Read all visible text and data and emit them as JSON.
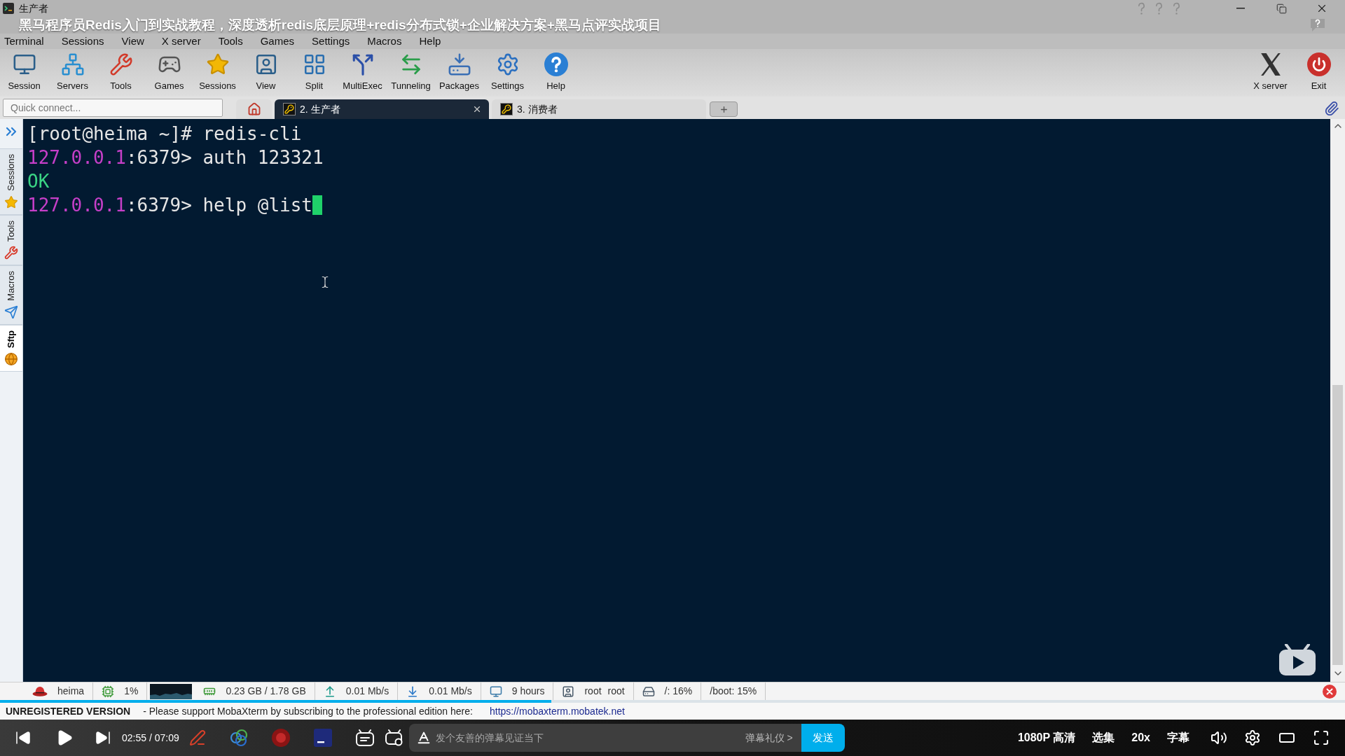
{
  "window": {
    "title": "生产者"
  },
  "video_title": "黑马程序员Redis入门到实战教程，深度透析redis底层原理+redis分布式锁+企业解决方案+黑马点评实战项目",
  "menu": [
    "Terminal",
    "Sessions",
    "View",
    "X server",
    "Tools",
    "Games",
    "Settings",
    "Macros",
    "Help"
  ],
  "toolbar": {
    "left": [
      "Session",
      "Servers",
      "Tools",
      "Games",
      "Sessions",
      "View",
      "Split",
      "MultiExec",
      "Tunneling",
      "Packages",
      "Settings",
      "Help"
    ],
    "right": [
      "X server",
      "Exit"
    ]
  },
  "quick_connect": {
    "placeholder": "Quick connect..."
  },
  "tabs": [
    {
      "kind": "home",
      "selected": false
    },
    {
      "kind": "session",
      "label": "2. 生产者",
      "selected": true
    },
    {
      "kind": "session",
      "label": "3. 消费者",
      "selected": false
    }
  ],
  "sidebar": {
    "tabs": [
      {
        "label": "Sessions",
        "selected": false
      },
      {
        "label": "Tools",
        "selected": false
      },
      {
        "label": "Macros",
        "selected": false
      },
      {
        "label": "Sftp",
        "selected": true
      }
    ]
  },
  "terminal": {
    "lines": [
      {
        "segments": [
          {
            "text": "[root@heima ~]# redis-cli",
            "color": "#e6e6e6"
          }
        ],
        "cursor": false
      },
      {
        "segments": [
          {
            "text": "127.0.0.1",
            "color": "#c63fc8"
          },
          {
            "text": ":6379> auth 123321",
            "color": "#e6e6e6"
          }
        ],
        "cursor": false
      },
      {
        "segments": [
          {
            "text": "OK",
            "color": "#3ad484"
          }
        ],
        "cursor": false
      },
      {
        "segments": [
          {
            "text": "127.0.0.1",
            "color": "#c63fc8"
          },
          {
            "text": ":6379> help @list",
            "color": "#e6e6e6"
          }
        ],
        "cursor": true
      }
    ]
  },
  "status_bar": {
    "items": [
      {
        "kind": "host",
        "text": "heima"
      },
      {
        "kind": "cpu",
        "text": "1%"
      },
      {
        "kind": "graph"
      },
      {
        "kind": "memory",
        "text": "0.23 GB / 1.78 GB"
      },
      {
        "kind": "upload",
        "text": "0.01 Mb/s"
      },
      {
        "kind": "download",
        "text": "0.01 Mb/s"
      },
      {
        "kind": "uptime",
        "text": "9 hours"
      },
      {
        "kind": "user",
        "text": "root root"
      },
      {
        "kind": "disk",
        "text": "/: 16%"
      },
      {
        "kind": "partition",
        "text": "/boot: 15%"
      }
    ]
  },
  "notice": {
    "label": "UNREGISTERED VERSION",
    "message": "- Please support MobaXterm by subscribing to the professional edition here:",
    "link": "https://mobaxterm.mobatek.net"
  },
  "player": {
    "progress": {
      "level": 0.41
    },
    "playing": false,
    "time": "02:55 / 07:09",
    "danmaku_input": {
      "placeholder": "发个友善的弹幕见证当下"
    },
    "etiquette_link": "弹幕礼仪 >",
    "send_button": "发送",
    "quality": "1080P 高清",
    "episodes": "选集",
    "speed": "20x",
    "subtitles": "字幕"
  }
}
